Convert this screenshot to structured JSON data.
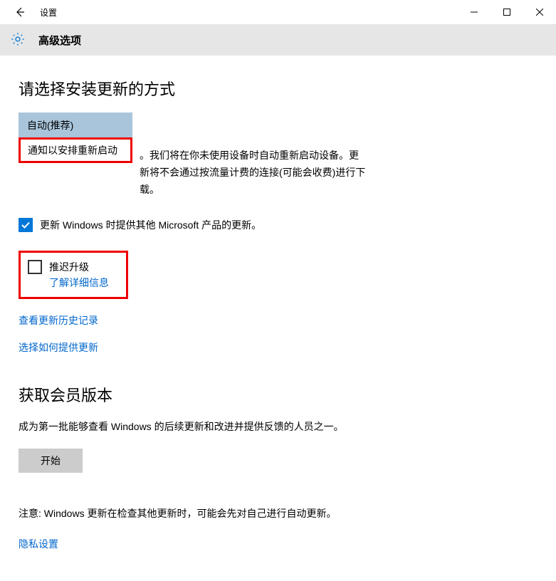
{
  "titlebar": {
    "title": "设置"
  },
  "header": {
    "title": "高级选项"
  },
  "main": {
    "heading": "请选择安装更新的方式",
    "dropdown": {
      "option1": "自动(推荐)",
      "option2": "通知以安排重新启动"
    },
    "desc_trailing": "。我们将在你未使用设备时自动重新启动设备。更新将不会通过按流量计费的连接(可能会收费)进行下载。",
    "checkbox_ms_products": {
      "label": "更新 Windows 时提供其他 Microsoft 产品的更新。",
      "checked": true
    },
    "defer_box": {
      "label": "推迟升级",
      "learn_more": "了解详细信息",
      "checked": false
    },
    "link_history": "查看更新历史记录",
    "link_delivery": "选择如何提供更新"
  },
  "insider": {
    "heading": "获取会员版本",
    "desc": "成为第一批能够查看 Windows 的后续更新和改进并提供反馈的人员之一。",
    "start_btn": "开始",
    "note": "注意: Windows 更新在检查其他更新时，可能会先对自己进行自动更新。",
    "privacy_link": "隐私设置"
  }
}
